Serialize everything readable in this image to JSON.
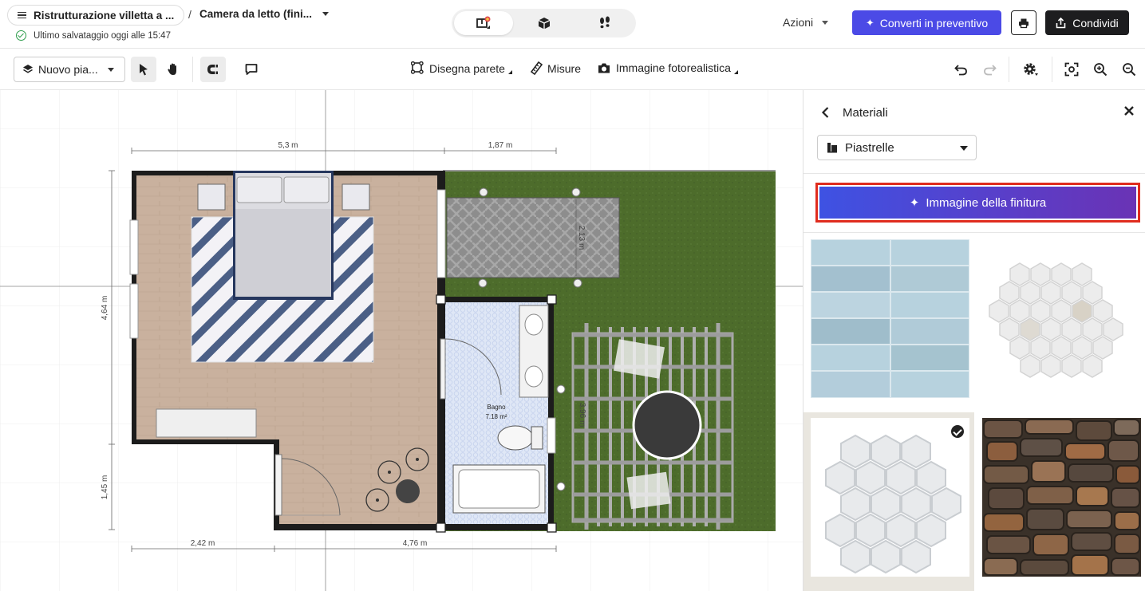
{
  "header": {
    "project_name": "Ristrutturazione villetta a ...",
    "separator": "/",
    "room_name": "Camera da letto (fini...",
    "save_status": "Ultimo salvataggio oggi alle 15:47",
    "actions_label": "Azioni",
    "quote_button": "Converti in preventivo",
    "share_button": "Condividi"
  },
  "toolbar": {
    "floor_select": "Nuovo pia...",
    "draw_wall": "Disegna parete",
    "measures": "Misure",
    "photo_image": "Immagine fotorealistica"
  },
  "plan": {
    "dim_top_left": "5,3 m",
    "dim_top_right": "1,87 m",
    "dim_left_top": "4,64 m",
    "dim_left_bottom": "1,45 m",
    "dim_bottom_left": "2,42 m",
    "dim_bottom_right": "4,76 m",
    "dim_patio": "2,13 m",
    "dim_pergola": "3,96 m",
    "bathroom_name": "Bagno",
    "bathroom_area": "7.18 m²"
  },
  "panel": {
    "title": "Materiali",
    "category": "Piastrelle",
    "finish_button": "Immagine della finitura",
    "materials": [
      {
        "icon": "light-blue-subway-tile",
        "selected": false
      },
      {
        "icon": "small-hexagon-marble-tile",
        "selected": false
      },
      {
        "icon": "large-hexagon-marble-tile",
        "selected": true
      },
      {
        "icon": "stone-wall-texture",
        "selected": false
      }
    ]
  },
  "colors": {
    "accent": "#4b4ae6",
    "highlight": "#e02c1e",
    "grass": "#4e6d2a",
    "floor_wood": "#c9b29f"
  }
}
